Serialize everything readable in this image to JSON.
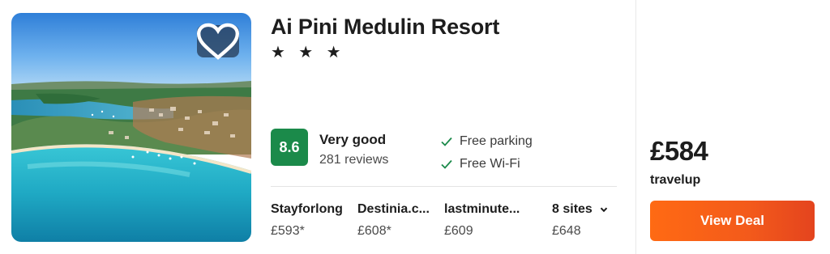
{
  "hotel": {
    "name": "Ai Pini Medulin Resort",
    "stars": "★ ★ ★",
    "rating": {
      "score": "8.6",
      "label": "Very good",
      "reviews": "281 reviews",
      "badge_color": "#1b8a4a"
    },
    "amenities": [
      {
        "label": "Free parking",
        "icon": "check-icon"
      },
      {
        "label": "Free Wi-Fi",
        "icon": "check-icon"
      }
    ],
    "favorite_icon": "heart-icon"
  },
  "sites": [
    {
      "name": "Stayforlong",
      "price": "£593*"
    },
    {
      "name": "Destinia.c...",
      "price": "£608*"
    },
    {
      "name": "lastminute...",
      "price": "£609"
    }
  ],
  "more_sites": {
    "label": "8 sites",
    "price": "£648",
    "icon": "chevron-down-icon"
  },
  "deal": {
    "price": "£584",
    "provider": "travelup",
    "button_label": "View Deal",
    "button_color": "#f35a1b"
  }
}
